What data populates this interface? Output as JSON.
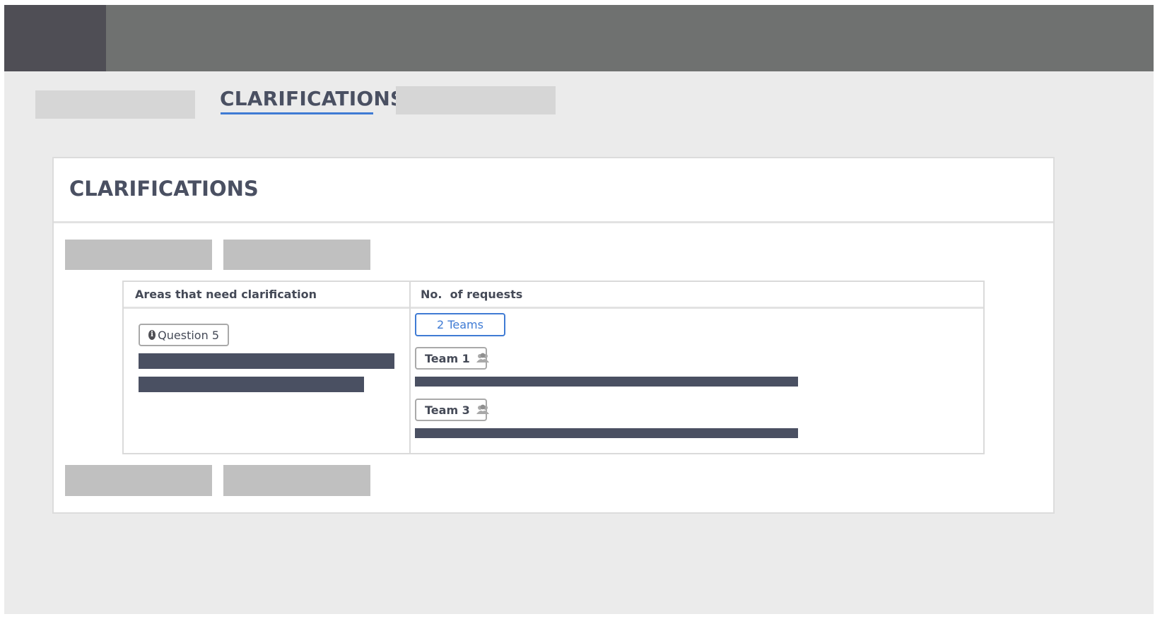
{
  "nav": {
    "active_tab": "CLARIFICATIONS"
  },
  "panel": {
    "title": "CLARIFICATIONS"
  },
  "table": {
    "headers": [
      "Areas that need clarification",
      "No.  of requests"
    ],
    "rows": [
      {
        "area": {
          "label": "Question 5",
          "icon": "info-circle-icon"
        },
        "requests": {
          "teams_button": "2 Teams",
          "teams": [
            {
              "name": "Team 1",
              "icon": "group-icon"
            },
            {
              "name": "Team 3",
              "icon": "group-icon"
            }
          ]
        }
      }
    ]
  },
  "colors": {
    "topbar": "#6f7170",
    "logo_block": "#4f4e55",
    "accent": "#3f7bd4",
    "text_dark": "#4a5062",
    "redacted_bar": "#4a5062",
    "placeholder": "#c0c0c0"
  }
}
